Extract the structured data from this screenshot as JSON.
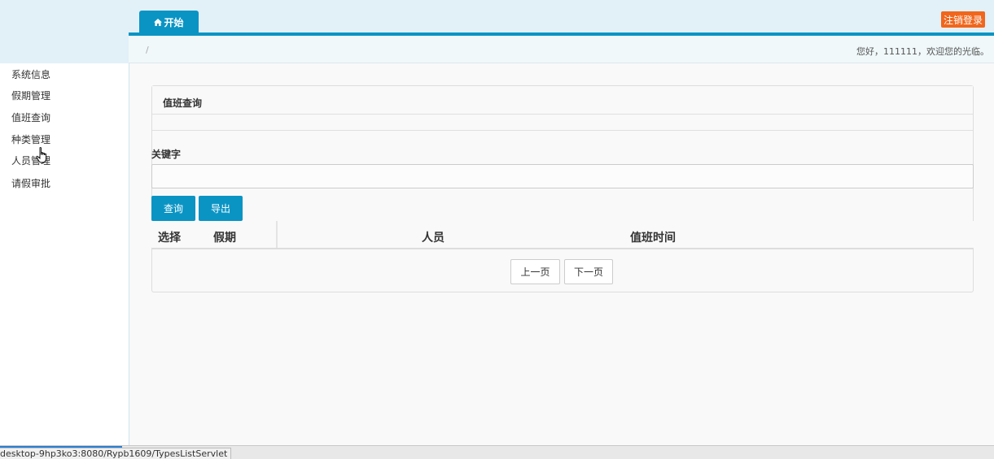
{
  "header": {
    "home_tab": "开始",
    "logout_button": "注销登录"
  },
  "sidebar": {
    "items": [
      {
        "label": "系统信息"
      },
      {
        "label": "假期管理"
      },
      {
        "label": "值班查询"
      },
      {
        "label": "种类管理"
      },
      {
        "label": "人员管理"
      },
      {
        "label": "请假审批"
      }
    ]
  },
  "breadcrumb": {
    "separator": "/",
    "welcome": "您好，111111，欢迎您的光临。"
  },
  "panel": {
    "title": "值班查询"
  },
  "search": {
    "label": "关键字",
    "value": "",
    "placeholder": ""
  },
  "buttons": {
    "query": "查询",
    "export": "导出"
  },
  "table": {
    "columns": [
      "选择",
      "假期",
      "人员",
      "值班时间"
    ]
  },
  "pager": {
    "prev": "上一页",
    "next": "下一页"
  },
  "status": {
    "url": "desktop-9hp3ko3:8080/Rypb1609/TypesListServlet"
  },
  "colors": {
    "accent": "#0a94c4",
    "logout": "#f0661c",
    "header_bg": "#e2f0f8"
  }
}
